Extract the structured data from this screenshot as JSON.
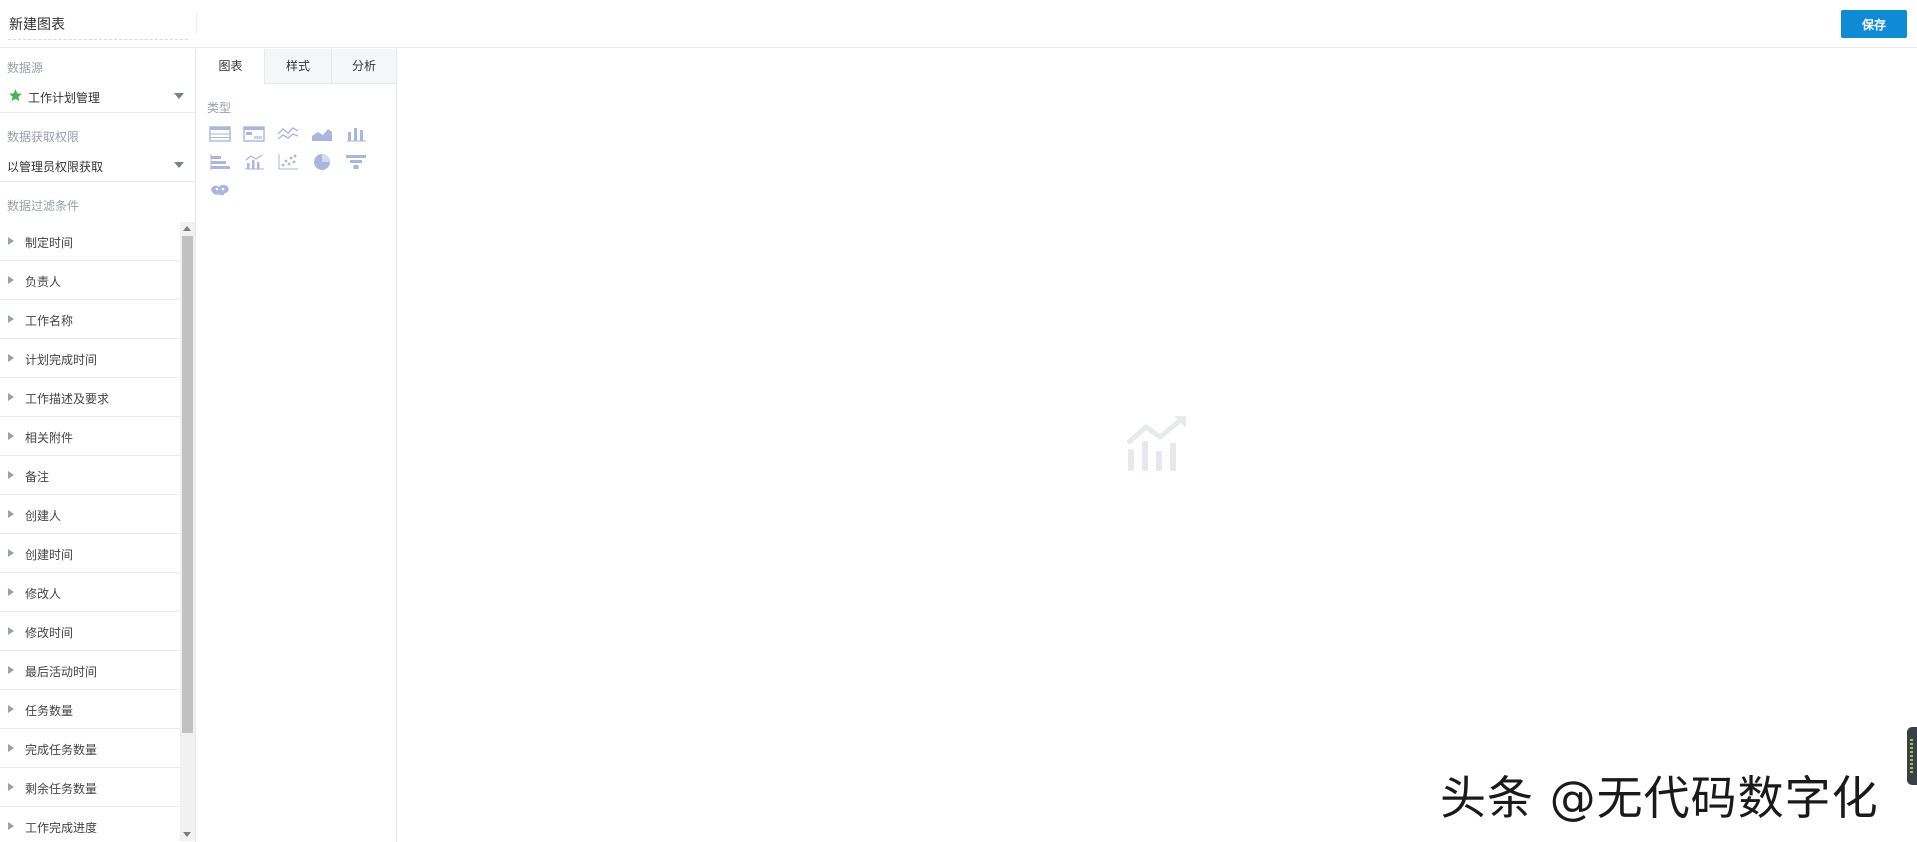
{
  "header": {
    "title": "新建图表",
    "save_label": "保存"
  },
  "left_panel": {
    "datasource_label": "数据源",
    "datasource_value": "工作计划管理",
    "permission_label": "数据获取权限",
    "permission_value": "以管理员权限获取",
    "filter_label": "数据过滤条件",
    "filters": [
      "制定时间",
      "负责人",
      "工作名称",
      "计划完成时间",
      "工作描述及要求",
      "相关附件",
      "备注",
      "创建人",
      "创建时间",
      "修改人",
      "修改时间",
      "最后活动时间",
      "任务数量",
      "完成任务数量",
      "剩余任务数量",
      "工作完成进度"
    ]
  },
  "middle_panel": {
    "tabs": [
      "图表",
      "样式",
      "分析"
    ],
    "active_tab": "图表",
    "type_label": "类型",
    "chart_types": [
      "table-icon",
      "pivot-table-icon",
      "line-chart-icon",
      "area-chart-icon",
      "bar-chart-icon",
      "horizontal-bar-icon",
      "combo-chart-icon",
      "scatter-chart-icon",
      "pie-chart-icon",
      "funnel-chart-icon",
      "map-chart-icon"
    ]
  },
  "canvas": {
    "empty_state_icon": "chart-placeholder-icon",
    "watermark": "头条 @无代码数字化"
  },
  "colors": {
    "primary": "#0f8bd6",
    "star": "#4caf50",
    "icon": "#a9b6dd",
    "border": "#e9ebef",
    "muted_text": "#9aa0a8"
  }
}
